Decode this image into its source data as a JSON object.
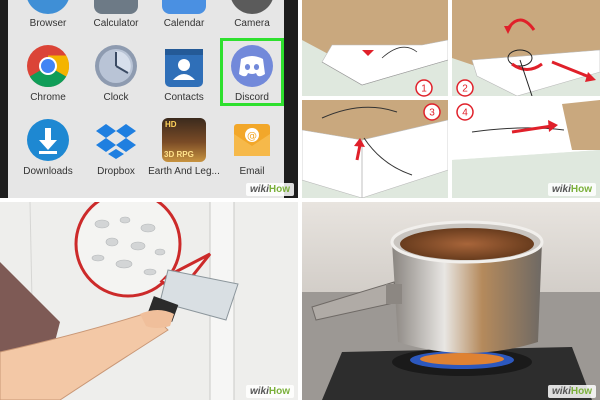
{
  "apps_top_row": [
    "Browser",
    "Calculator",
    "Calendar",
    "Camera"
  ],
  "apps": [
    {
      "label": "Chrome",
      "icon": "chrome-icon"
    },
    {
      "label": "Clock",
      "icon": "clock-icon"
    },
    {
      "label": "Contacts",
      "icon": "contacts-icon"
    },
    {
      "label": "Discord",
      "icon": "discord-icon"
    },
    {
      "label": "Downloads",
      "icon": "downloads-icon"
    },
    {
      "label": "Dropbox",
      "icon": "dropbox-icon"
    },
    {
      "label": "Earth And Leg...",
      "icon": "game-icon"
    },
    {
      "label": "Email",
      "icon": "email-icon"
    }
  ],
  "game_icon_text": [
    "HD",
    "3D RPG"
  ],
  "stitch_steps": [
    "1",
    "2",
    "3",
    "4"
  ],
  "watermark": {
    "part1": "wiki",
    "part2": "How"
  },
  "colors": {
    "highlight": "#2ee02e",
    "discord": "#7289da",
    "step_marker": "#e0202a",
    "watermark_green": "#7bb03b"
  }
}
